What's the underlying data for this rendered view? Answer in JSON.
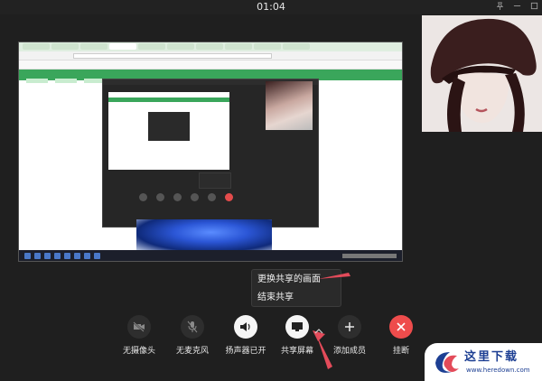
{
  "window": {
    "timer": "01:04",
    "pin_icon": "pin-icon",
    "minimize_icon": "minimize-icon",
    "maximize_icon": "maximize-icon"
  },
  "share_menu": {
    "change_shared_screen": "更换共享的画面",
    "end_sharing": "结束共享"
  },
  "controls": {
    "camera_off": {
      "label": "无摄像头",
      "icon": "camera-off-icon"
    },
    "mic_off": {
      "label": "无麦克风",
      "icon": "mic-off-icon"
    },
    "speaker_on": {
      "label": "扬声器已开",
      "icon": "speaker-icon"
    },
    "share_screen": {
      "label": "共享屏幕",
      "icon": "screen-share-icon"
    },
    "add_member": {
      "label": "添加成员",
      "icon": "plus-icon"
    },
    "hang_up": {
      "label": "挂断",
      "icon": "close-icon"
    }
  },
  "watermark": {
    "site_name": "这里下载",
    "url": "www.heredown.com"
  },
  "colors": {
    "background": "#1f1f1f",
    "hang_up": "#ee4c4c",
    "annotation_arrow": "#e34b5a",
    "site_green": "#3aa65b",
    "watermark_blue": "#1d3f93"
  }
}
